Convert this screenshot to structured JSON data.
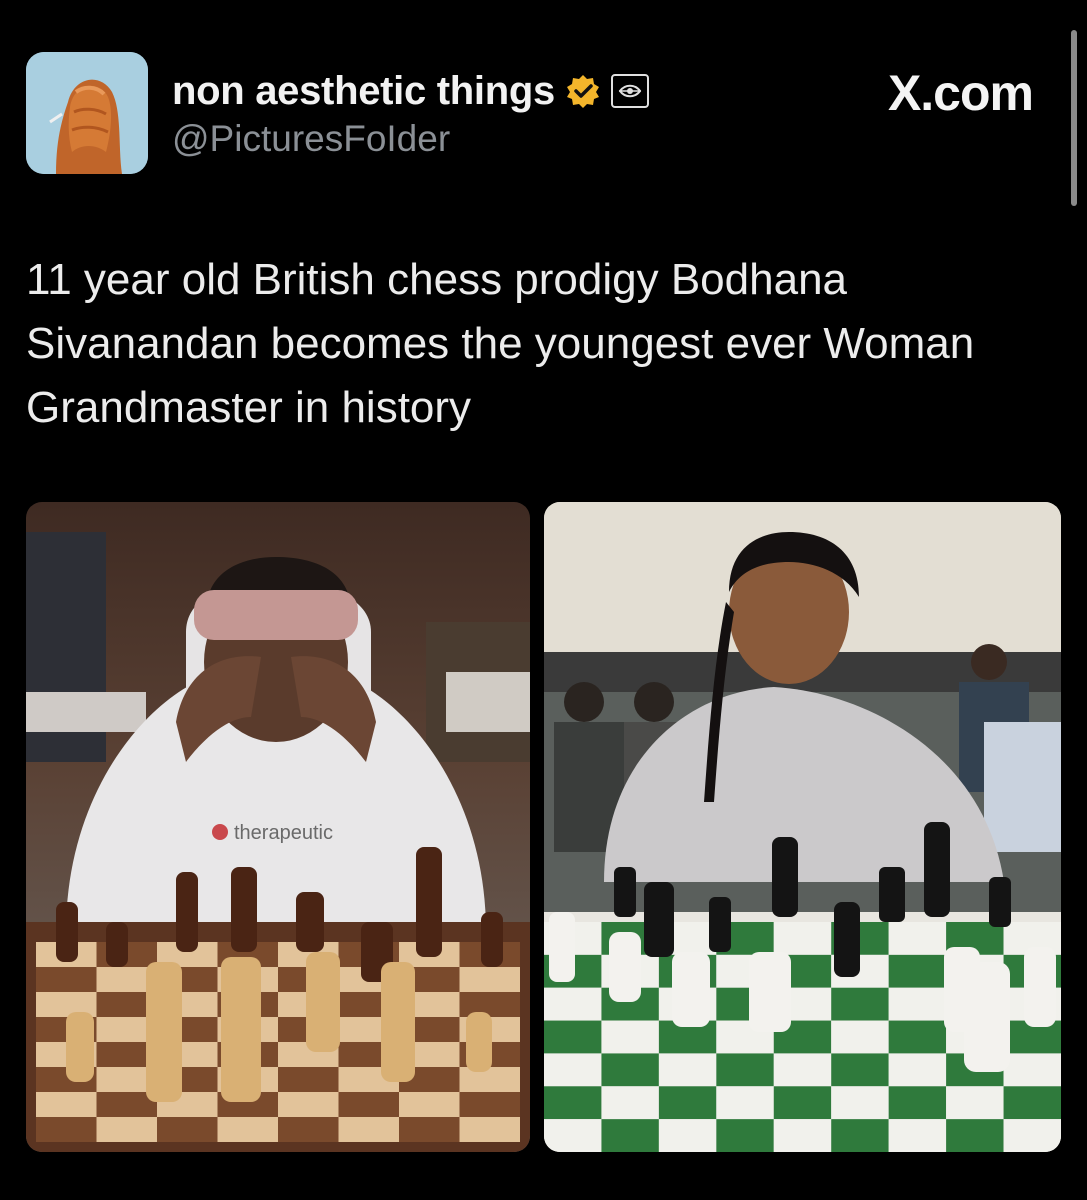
{
  "header": {
    "display_name": "non aesthetic things",
    "handle": "@PicturesFoIder",
    "brand": "X.com",
    "verified_color": "#f3b52b"
  },
  "post": {
    "text": "11 year old British chess prodigy Bodhana Sivanandan becomes the youngest ever Woman Grandmaster in history"
  },
  "media": {
    "left_photo": {
      "sweatshirt_text": "therapeutic"
    },
    "right_photo": {}
  },
  "colors": {
    "background": "#000000",
    "text": "#e7e9ea",
    "secondary_text": "#8b9096",
    "board_green": "#2f7a3c"
  }
}
